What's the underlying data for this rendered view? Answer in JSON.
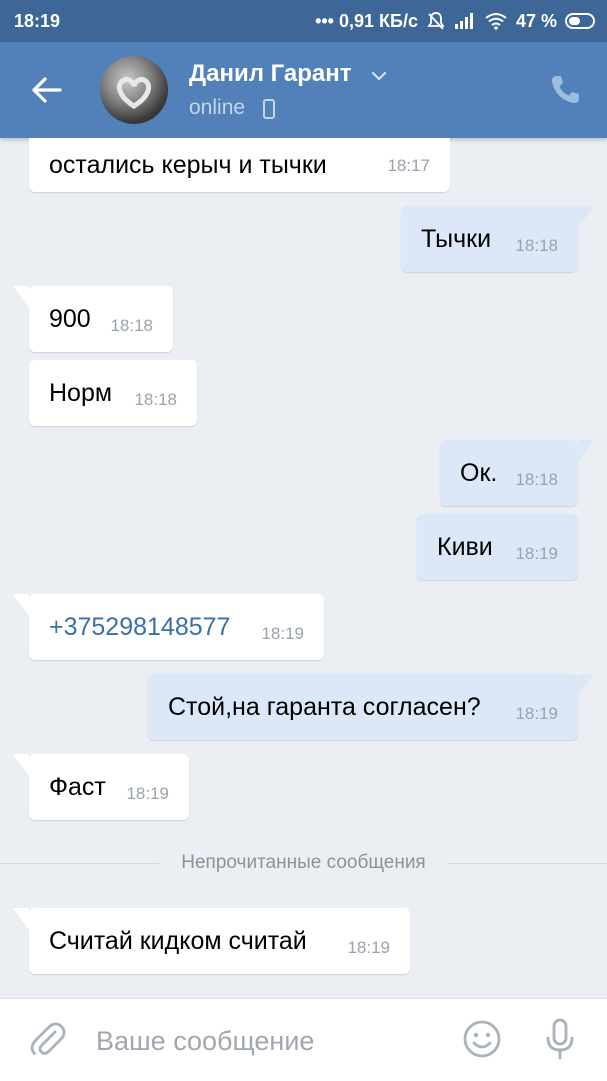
{
  "status_bar": {
    "time": "18:19",
    "speed": "••• 0,91 КБ/с",
    "battery": "47 %",
    "icons": [
      "mute-icon",
      "signal-icon",
      "wifi-icon",
      "battery-icon"
    ]
  },
  "header": {
    "contact_name": "Данил Гарант",
    "status": "online",
    "icons": [
      "back-arrow-icon",
      "chevron-down-icon",
      "mobile-phone-icon",
      "call-icon"
    ]
  },
  "messages": [
    {
      "dir": "in",
      "text": "остались керыч и тычки",
      "time": "18:17"
    },
    {
      "dir": "out",
      "text": "Тычки",
      "time": "18:18"
    },
    {
      "dir": "in",
      "text": "900",
      "time": "18:18"
    },
    {
      "dir": "in",
      "text": "Норм",
      "time": "18:18"
    },
    {
      "dir": "out",
      "text": "Ок.",
      "time": "18:18"
    },
    {
      "dir": "out",
      "text": "Киви",
      "time": "18:19"
    },
    {
      "dir": "in",
      "text": "+375298148577",
      "time": "18:19",
      "link": true
    },
    {
      "dir": "out",
      "text": "Стой,на гаранта согласен?",
      "time": "18:19"
    },
    {
      "dir": "in",
      "text": "Фаст",
      "time": "18:19"
    },
    {
      "dir": "in",
      "text": "Считай кидком считай",
      "time": "18:19"
    }
  ],
  "unread_divider": "Непрочитанные сообщения",
  "input": {
    "placeholder": "Ваше сообщение",
    "icons": [
      "paperclip-icon",
      "emoji-icon",
      "microphone-icon"
    ]
  },
  "colors": {
    "header": "#5181b8",
    "status_bar": "#3e6697",
    "chat_bg": "#ebeef2",
    "outgoing_bubble": "#dce8f8",
    "incoming_bubble": "#ffffff",
    "link": "#3a6fa8"
  }
}
